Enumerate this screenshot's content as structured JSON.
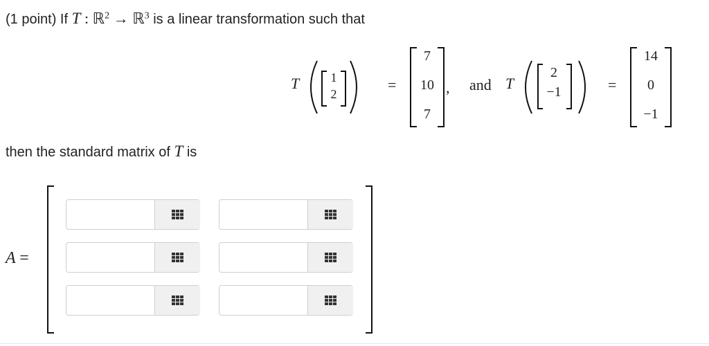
{
  "problem": {
    "intro_pre": "(1 point) If",
    "map_T": "T",
    "colon": ":",
    "domain": "ℝ",
    "domain_exp": "2",
    "arrow": "→",
    "codomain": "ℝ",
    "codomain_exp": "3",
    "intro_post": "is a linear transformation such that",
    "then_pre": "then the standard matrix of",
    "then_T": "T",
    "then_post": "is"
  },
  "equation": {
    "T_symbol": "T",
    "eq_sign": "=",
    "and_word": "and",
    "comma": ",",
    "input1": [
      "1",
      "2"
    ],
    "output1": [
      "7",
      "10",
      "7"
    ],
    "input2": [
      "2",
      "−1"
    ],
    "output2": [
      "14",
      "0",
      "−1"
    ]
  },
  "answer": {
    "matrix_label": "A",
    "eq_sign": "=",
    "cells": [
      {
        "value": "",
        "palette_icon": "grid-icon"
      },
      {
        "value": "",
        "palette_icon": "grid-icon"
      },
      {
        "value": "",
        "palette_icon": "grid-icon"
      },
      {
        "value": "",
        "palette_icon": "grid-icon"
      },
      {
        "value": "",
        "palette_icon": "grid-icon"
      },
      {
        "value": "",
        "palette_icon": "grid-icon"
      }
    ]
  }
}
